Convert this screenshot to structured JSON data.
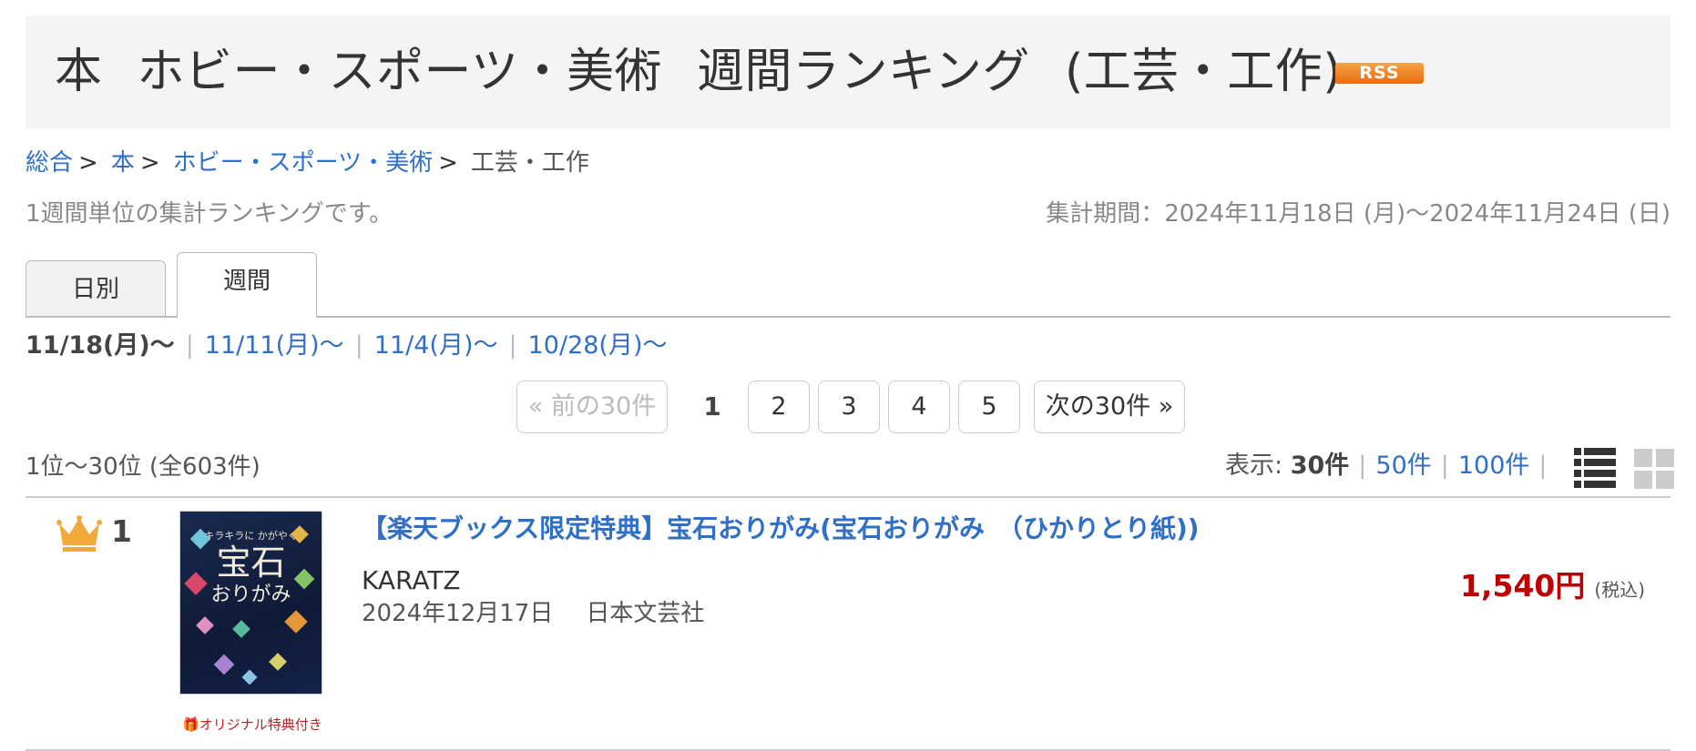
{
  "header": {
    "title_parts": [
      "本",
      "ホビー・スポーツ・美術",
      "週間ランキング",
      "(工芸・工作)"
    ],
    "rss_label": "RSS"
  },
  "breadcrumb": {
    "items": [
      "総合",
      "本",
      "ホビー・スポーツ・美術"
    ],
    "separator": ">",
    "current": "工芸・工作"
  },
  "description": "1週間単位の集計ランキングです。",
  "period": "集計期間：2024年11月18日 (月)〜2024年11月24日 (日)",
  "tabs": [
    {
      "label": "日別",
      "active": false
    },
    {
      "label": "週間",
      "active": true
    }
  ],
  "weeks": {
    "current": "11/18(月)〜",
    "others": [
      "11/11(月)〜",
      "11/4(月)〜",
      "10/28(月)〜"
    ]
  },
  "pagination": {
    "prev_label": "« 前の30件",
    "current_page": "1",
    "pages": [
      "2",
      "3",
      "4",
      "5"
    ],
    "next_label": "次の30件 »"
  },
  "result_count": "1位〜30位 (全603件)",
  "display": {
    "label": "表示:",
    "current": "30件",
    "options": [
      "50件",
      "100件"
    ],
    "separator": "|"
  },
  "items": [
    {
      "rank": "1",
      "title": "【楽天ブックス限定特典】宝石おりがみ(宝石おりがみ　（ひかりとり紙))",
      "author": "KARATZ",
      "date": "2024年12月17日",
      "publisher": "日本文芸社",
      "price": "1,540円",
      "tax_note": "(税込)",
      "bonus_label": "オリジナル特典付き",
      "cover": {
        "small_text": "キラキラに かがやく",
        "big_text": "宝石",
        "sub_text": "おりがみ"
      }
    }
  ],
  "colors": {
    "link": "#2f6fc7",
    "price": "#bf0000",
    "crown": "#f2a93b",
    "rss": "#e86c0f",
    "header_bg": "#f4f4f4"
  },
  "icons": {
    "crown": "crown-icon",
    "gift": "gift-icon",
    "list_view": "list-view-icon",
    "grid_view": "grid-view-icon"
  }
}
